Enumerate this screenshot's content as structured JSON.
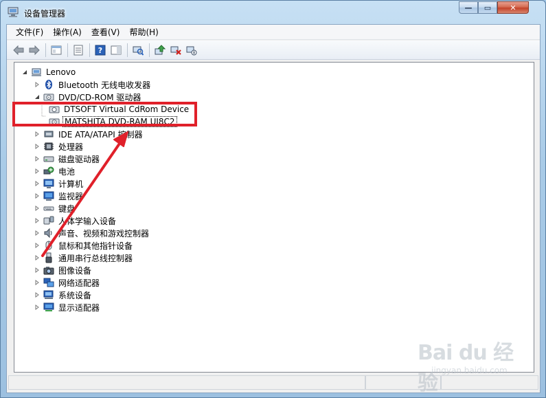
{
  "window": {
    "title": "设备管理器",
    "controls": {
      "minimize": "—",
      "maximize": "▭",
      "close": "✕"
    }
  },
  "menu": [
    {
      "label": "文件(F)"
    },
    {
      "label": "操作(A)"
    },
    {
      "label": "查看(V)"
    },
    {
      "label": "帮助(H)"
    }
  ],
  "toolbar": {
    "icons": [
      "back-arrow-icon",
      "forward-arrow-icon",
      "show-hide-console-tree-icon",
      "properties-icon",
      "help-icon",
      "show-action-pane-icon",
      "scan-hardware-icon",
      "update-driver-icon",
      "uninstall-device-icon",
      "disable-device-icon"
    ]
  },
  "tree": {
    "root": "Lenovo",
    "items": [
      {
        "label": "Bluetooth 无线电收发器",
        "icon": "bluetooth-icon"
      },
      {
        "label": "DVD/CD-ROM 驱动器",
        "icon": "dvd-drive-icon",
        "expanded": true,
        "children": [
          {
            "label": "DTSOFT Virtual CdRom Device",
            "icon": "dvd-drive-icon"
          },
          {
            "label": "MATSHITA DVD-RAM UJ8C2",
            "icon": "dvd-drive-icon",
            "selected": true
          }
        ]
      },
      {
        "label": "IDE ATA/ATAPI 控制器",
        "icon": "ide-controller-icon"
      },
      {
        "label": "处理器",
        "icon": "processor-icon"
      },
      {
        "label": "磁盘驱动器",
        "icon": "disk-drive-icon"
      },
      {
        "label": "电池",
        "icon": "battery-icon"
      },
      {
        "label": "计算机",
        "icon": "computer-icon"
      },
      {
        "label": "监视器",
        "icon": "monitor-icon"
      },
      {
        "label": "键盘",
        "icon": "keyboard-icon"
      },
      {
        "label": "人体学输入设备",
        "icon": "hid-icon"
      },
      {
        "label": "声音、视频和游戏控制器",
        "icon": "sound-icon"
      },
      {
        "label": "鼠标和其他指针设备",
        "icon": "mouse-icon"
      },
      {
        "label": "通用串行总线控制器",
        "icon": "usb-icon"
      },
      {
        "label": "图像设备",
        "icon": "camera-icon"
      },
      {
        "label": "网络适配器",
        "icon": "network-icon"
      },
      {
        "label": "系统设备",
        "icon": "system-device-icon"
      },
      {
        "label": "显示适配器",
        "icon": "display-adapter-icon"
      }
    ]
  },
  "watermark": {
    "logo": "Bai du 经验",
    "url": "jingyan.baidu.com"
  },
  "colors": {
    "highlight": "#e0202a",
    "arrow": "#e0202a"
  }
}
